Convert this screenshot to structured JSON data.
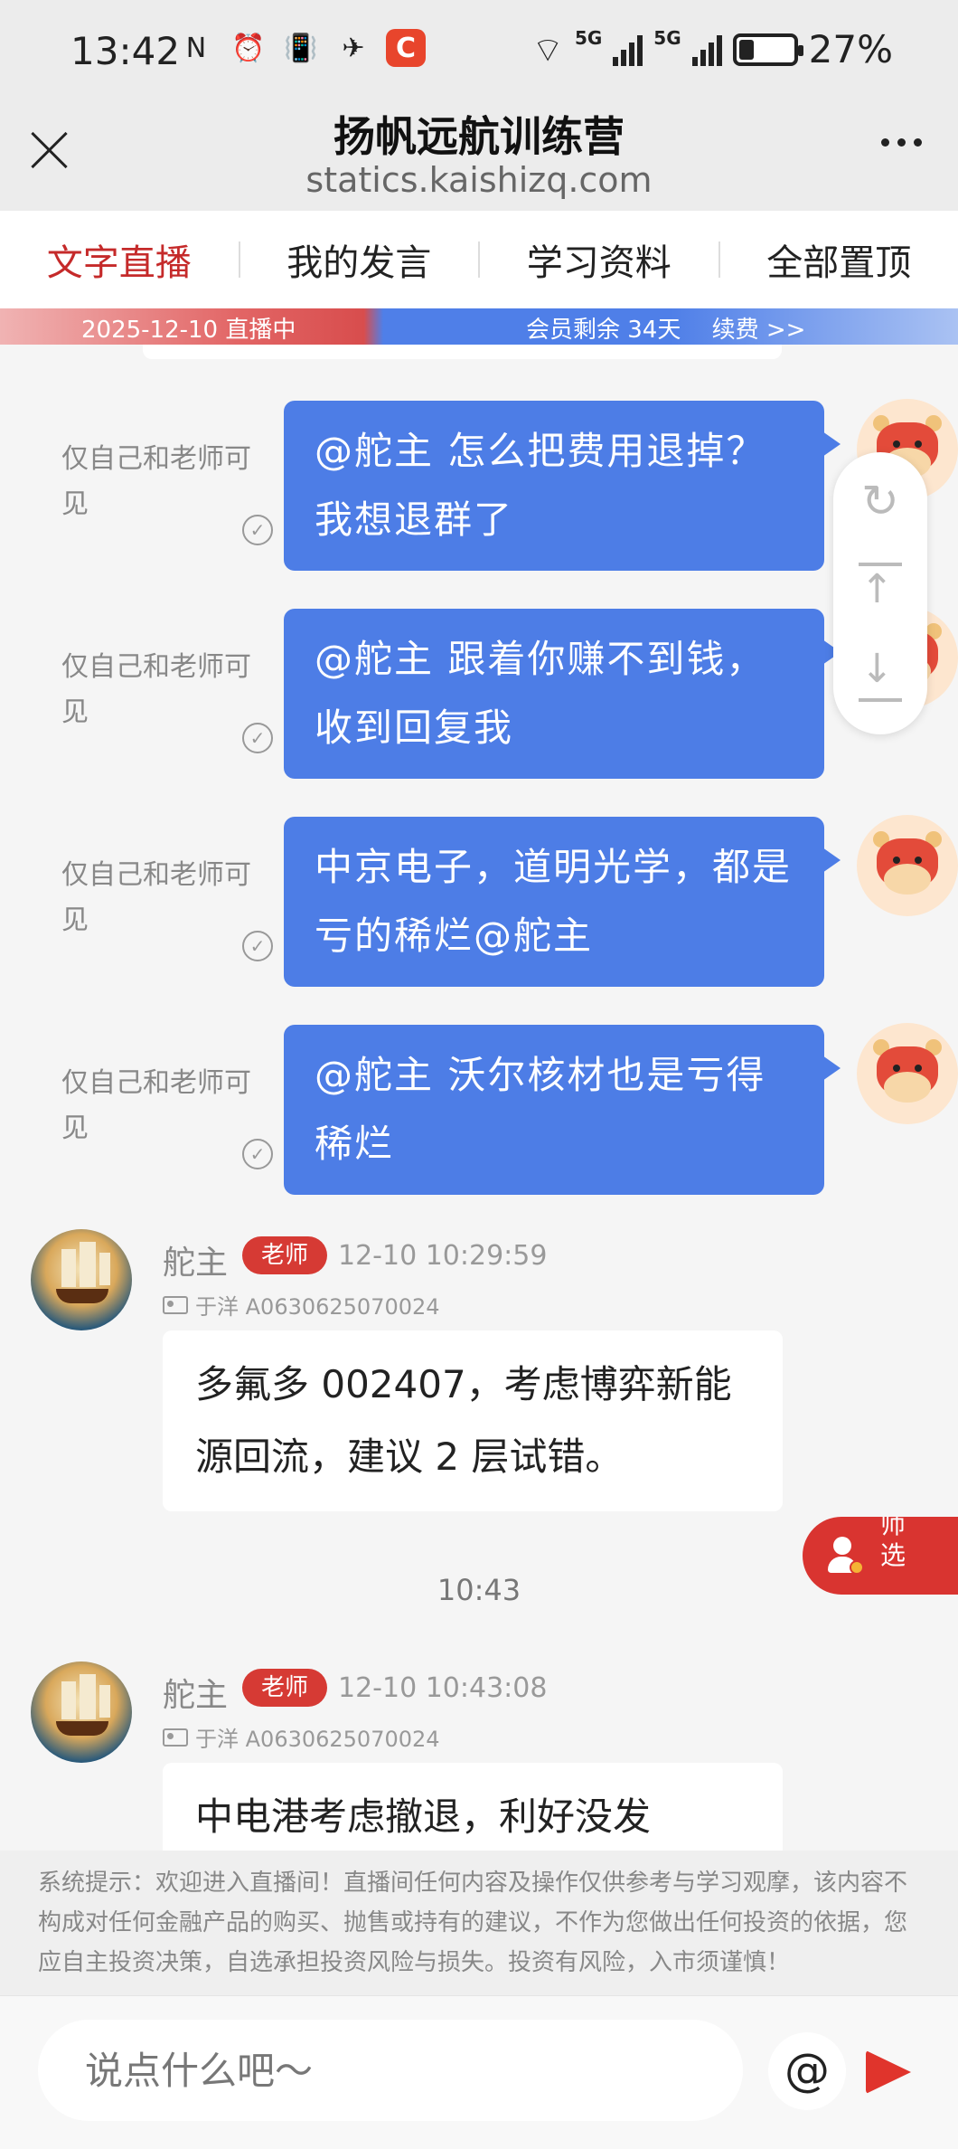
{
  "status_bar": {
    "time": "13:42",
    "left_icons": [
      "N",
      "⏰",
      "📳",
      "✈",
      "C"
    ],
    "network_1": "5G",
    "network_2": "5G",
    "battery_percent": "27%",
    "battery_level": 0.27
  },
  "title_bar": {
    "title": "扬帆远航训练营",
    "url": "statics.kaishizq.com"
  },
  "tabs": [
    {
      "label": "文字直播",
      "active": true
    },
    {
      "label": "我的发言",
      "active": false
    },
    {
      "label": "学习资料",
      "active": false
    },
    {
      "label": "全部置顶",
      "active": false
    }
  ],
  "banner": {
    "left_text": "2025-12-10 直播中",
    "right_text": "会员剩余 34天　 续费 >>"
  },
  "my_messages": [
    {
      "note": "仅自己和老师可见",
      "text": "@舵主 怎么把费用退掉？我想退群了"
    },
    {
      "note": "仅自己和老师可见",
      "text": "@舵主 跟着你赚不到钱，收到回复我"
    },
    {
      "note": "仅自己和老师可见",
      "text": "中京电子，道明光学，都是亏的稀烂@舵主"
    },
    {
      "note": "仅自己和老师可见",
      "text": "@舵主 沃尔核材也是亏得稀烂"
    }
  ],
  "teacher_messages": [
    {
      "name": "舵主",
      "badge": "老师",
      "time": "12-10 10:29:59",
      "id": "于洋 A0630625070024",
      "text": "多氟多 002407，考虑博弈新能源回流，建议 2 层试错。"
    },
    {
      "name": "舵主",
      "badge": "老师",
      "time": "12-10 10:43:08",
      "id": "于洋 A0630625070024",
      "text": "中电港考虑撤退，利好没发"
    }
  ],
  "time_separator": "10:43",
  "teacher_select": {
    "label": "老师选择",
    "visible_text": "师\n选"
  },
  "disclaimer": "系统提示：欢迎进入直播间！直播间任何内容及操作仅供参考与学习观摩，该内容不构成对任何金融产品的购买、抛售或持有的建议，不作为您做出任何投资的依据，您应自主投资决策，自选承担投资风险与损失。投资有风险，入市须谨慎！",
  "input": {
    "placeholder": "说点什么吧～",
    "at_label": "@"
  },
  "colors": {
    "accent_red": "#c52a2a",
    "bubble_blue": "#4d7de6",
    "badge_red": "#d63a34"
  },
  "icons": {
    "close": "close-icon",
    "more": "more-icon",
    "refresh": "refresh-icon",
    "to_top": "to-top-icon",
    "to_bottom": "to-bottom-icon",
    "send": "send-icon",
    "at": "at-icon",
    "verified": "check-icon",
    "id_card": "id-card-icon",
    "teacher": "teacher-icon"
  }
}
